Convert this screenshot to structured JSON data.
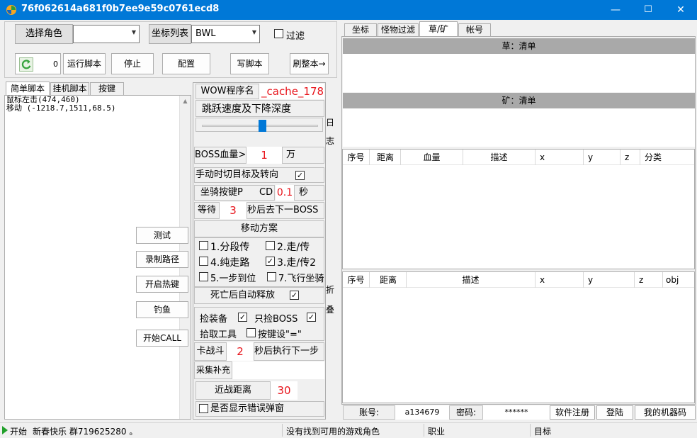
{
  "window": {
    "title": "76f062614a681f0b7ee9e59c0761ecd8",
    "minimize": "—",
    "maximize": "☐",
    "close": "✕"
  },
  "top": {
    "select_role": "选择角色",
    "role_value": "",
    "coord_list": "坐标列表",
    "coord_value": "BWL",
    "filter_label": "过滤"
  },
  "toolbar": {
    "counter": "0",
    "run_script": "运行脚本",
    "stop": "停止",
    "config": "配置",
    "write_script": "写脚本",
    "refresh": "刷整本→"
  },
  "left_tabs": [
    "简单脚本",
    "挂机脚本",
    "按键"
  ],
  "script_lines": [
    "鼠标左击(474,460)",
    "移动 (-1218.7,1511,68.5)"
  ],
  "side_buttons": {
    "test": "测试",
    "record_path": "录制路径",
    "hotkey": "开启热键",
    "fishing": "钓鱼",
    "start_call": "开始CALL"
  },
  "mid": {
    "wow_label": "WOW程序名",
    "wow_value": "_cache_178",
    "jump_label": "跳跃速度及下降深度",
    "slider_value": 0.52,
    "log_v": "日志",
    "fold_v": "折叠",
    "boss_hp": "BOSS血量>",
    "boss_hp_val": "1",
    "boss_hp_unit": "万",
    "manual_switch": "手动时切目标及转向",
    "mount_key": "坐骑按键P",
    "cd_label": "CD",
    "cd_val": "0.1",
    "cd_unit": "秒",
    "wait_label": "等待",
    "wait_val": "3",
    "wait_after": "秒后去下一BOSS",
    "move_plan": "移动方案",
    "opt1": "1.分段传",
    "opt2": "2.走/传",
    "opt3": "3.走/传2",
    "opt4": "4.纯走路",
    "opt5": "5.一步到位",
    "opt7": "7.飞行坐骑",
    "auto_release": "死亡后自动释放",
    "pick_equip": "捡装备",
    "pick_boss": "只捡BOSS",
    "pick_tool": "拾取工具",
    "key_set": "按键设\"=\"",
    "stuck_label": "卡战斗",
    "stuck_val": "2",
    "stuck_after": "秒后执行下一步",
    "gather_label": "采集补充",
    "gather_val": "",
    "melee_label": "近战距离",
    "melee_val": "30",
    "show_error": "是否显示错误弹窗"
  },
  "right_tabs": [
    "坐标",
    "怪物过滤",
    "草/矿",
    "帐号"
  ],
  "herb_header": "草：清单",
  "ore_header": "矿：清单",
  "table1_headers": [
    "序号",
    "距离",
    "血量",
    "描述",
    "x",
    "y",
    "z",
    "分类"
  ],
  "table2_headers": [
    "序号",
    "距离",
    "描述",
    "x",
    "y",
    "z",
    "obj"
  ],
  "account": {
    "label": "账号:",
    "value": "a134679",
    "pwd_label": "密码:",
    "pwd_value": "******",
    "register": "软件注册",
    "login": "登陆",
    "machine": "我的机器码"
  },
  "status": {
    "start": "开始",
    "greeting": "新春快乐 群719625280 。",
    "game_status": "没有找到可用的游戏角色",
    "job": "职业",
    "target": "目标"
  },
  "colors": {
    "titlebar": "#0078d7",
    "accent_red": "#e8141b",
    "slider_thumb": "#0078d7"
  }
}
